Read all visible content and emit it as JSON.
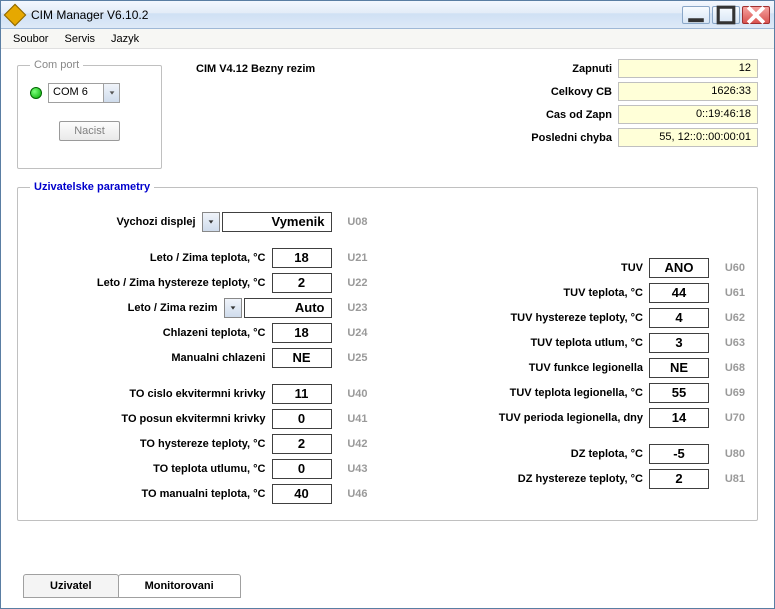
{
  "window": {
    "title": "CIM Manager  V6.10.2"
  },
  "menu": {
    "soubor": "Soubor",
    "servis": "Servis",
    "jazyk": "Jazyk"
  },
  "comport": {
    "legend": "Com port",
    "selected": "COM 6",
    "load_btn": "Nacist"
  },
  "status_line": "CIM V4.12  Bezny rezim",
  "stats": {
    "zapnuti_lbl": "Zapnuti",
    "zapnuti_val": "12",
    "celkovy_lbl": "Celkovy CB",
    "celkovy_val": "1626:33",
    "cas_lbl": "Cas od Zapn",
    "cas_val": "0::19:46:18",
    "chyba_lbl": "Posledni chyba",
    "chyba_val": "55, 12::0::00:00:01"
  },
  "params_legend": "Uzivatelske parametry",
  "left": [
    {
      "label": "Vychozi displej",
      "value": "Vymenik",
      "code": "U08",
      "dropdown": true,
      "wide": true
    },
    {
      "label": "Leto / Zima teplota, °C",
      "value": "18",
      "code": "U21",
      "gap": true
    },
    {
      "label": "Leto / Zima hystereze teploty, °C",
      "value": "2",
      "code": "U22"
    },
    {
      "label": "Leto / Zima rezim",
      "value": "Auto",
      "code": "U23",
      "dropdown": true,
      "med": true
    },
    {
      "label": "Chlazeni teplota, °C",
      "value": "18",
      "code": "U24"
    },
    {
      "label": "Manualni chlazeni",
      "value": "NE",
      "code": "U25"
    },
    {
      "label": "TO cislo ekvitermni krivky",
      "value": "11",
      "code": "U40",
      "gap": true
    },
    {
      "label": "TO posun ekvitermni krivky",
      "value": "0",
      "code": "U41"
    },
    {
      "label": "TO hystereze teploty, °C",
      "value": "2",
      "code": "U42"
    },
    {
      "label": "TO teplota utlumu, °C",
      "value": "0",
      "code": "U43"
    },
    {
      "label": "TO manualni teplota, °C",
      "value": "40",
      "code": "U46"
    }
  ],
  "right": [
    {
      "label": "TUV",
      "value": "ANO",
      "code": "U60"
    },
    {
      "label": "TUV teplota, °C",
      "value": "44",
      "code": "U61"
    },
    {
      "label": "TUV hystereze teploty, °C",
      "value": "4",
      "code": "U62"
    },
    {
      "label": "TUV teplota utlum, °C",
      "value": "3",
      "code": "U63"
    },
    {
      "label": "TUV funkce legionella",
      "value": "NE",
      "code": "U68"
    },
    {
      "label": "TUV teplota legionella, °C",
      "value": "55",
      "code": "U69"
    },
    {
      "label": "TUV perioda legionella, dny",
      "value": "14",
      "code": "U70"
    },
    {
      "label": "DZ teplota, °C",
      "value": "-5",
      "code": "U80",
      "gap": true
    },
    {
      "label": "DZ hystereze teploty, °C",
      "value": "2",
      "code": "U81"
    }
  ],
  "tabs": {
    "uzivatel": "Uzivatel",
    "monitorovani": "Monitorovani"
  }
}
